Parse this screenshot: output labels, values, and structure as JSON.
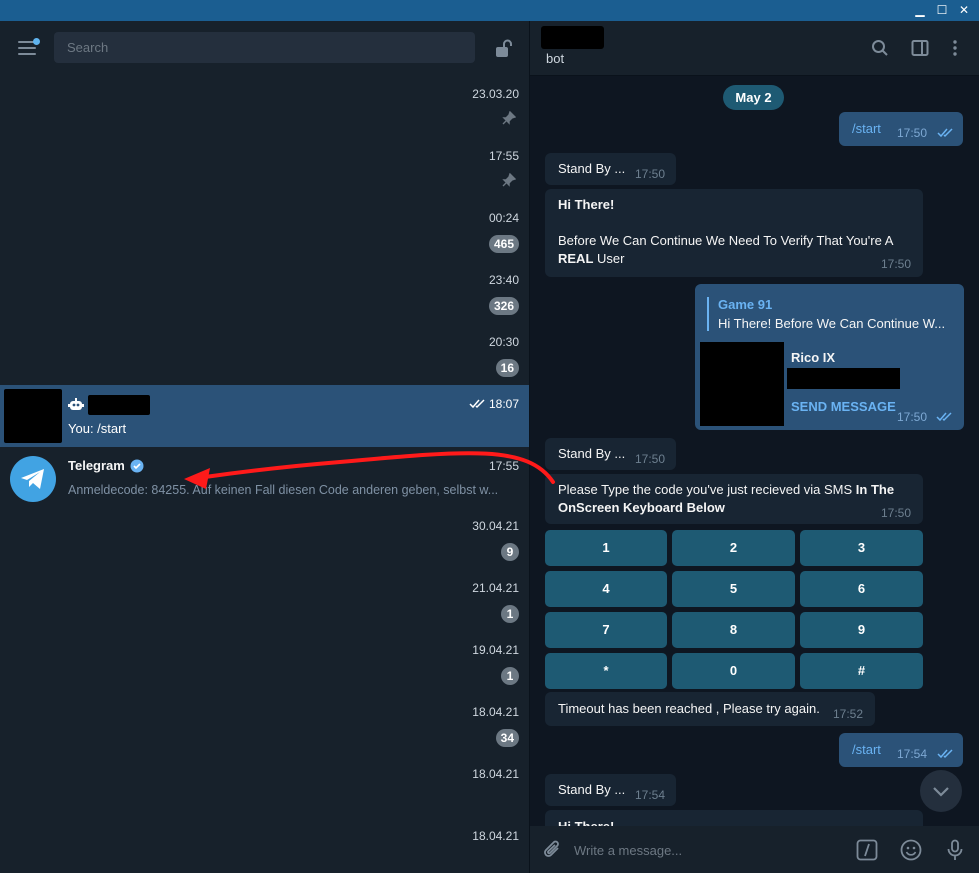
{
  "colors": {
    "titlebar": "#1b5e91",
    "sidebar": "#17212b",
    "chat_bg": "#0e1621",
    "active_row": "#2b5278",
    "keyboard_button": "#1e5a73",
    "annotation_arrow": "#ff1a1a"
  },
  "sidebar": {
    "search_placeholder": "Search",
    "chats": [
      {
        "date": "23.03.20",
        "pinned": true
      },
      {
        "date": "17:55",
        "pinned": true
      },
      {
        "date": "00:24",
        "unread": "465"
      },
      {
        "date": "23:40",
        "unread": "326"
      },
      {
        "date": "20:30",
        "unread": "16"
      },
      {
        "date": "18:07",
        "preview": "You: /start",
        "active": true
      },
      {
        "name": "Telegram",
        "date": "17:55",
        "preview": "Anmeldecode: 84255. Auf keinen Fall diesen Code anderen geben, selbst w..."
      },
      {
        "date": "30.04.21",
        "unread": "9"
      },
      {
        "date": "21.04.21",
        "unread": "1"
      },
      {
        "date": "19.04.21",
        "unread": "1"
      },
      {
        "date": "18.04.21",
        "unread": "34"
      },
      {
        "date": "18.04.21"
      },
      {
        "date": "18.04.21"
      }
    ]
  },
  "chat": {
    "header_subtitle": "bot",
    "date_pill": "May 2",
    "m1": {
      "text": "/start",
      "time": "17:50"
    },
    "m2": {
      "text": "Stand By ...",
      "time": "17:50"
    },
    "m3": {
      "line1": "Hi There!",
      "line2": "Before We Can Continue We Need To Verify That You're A",
      "line3_bold": "REAL",
      "line3_rest": " User",
      "time": "17:50"
    },
    "m4": {
      "quote_title": "Game 91",
      "quote_text": "Hi There!  Before We Can Continue W...",
      "contact_name": "Rico IX",
      "action": "SEND MESSAGE",
      "time": "17:50"
    },
    "m5": {
      "text": "Stand By ...",
      "time": "17:50"
    },
    "m6": {
      "text_a": "Please Type the code you've just recieved via SMS ",
      "text_b": "In The",
      "text_c": "OnScreen Keyboard Below",
      "time": "17:50"
    },
    "keyboard": [
      "1",
      "2",
      "3",
      "4",
      "5",
      "6",
      "7",
      "8",
      "9",
      "*",
      "0",
      "#"
    ],
    "m7": {
      "text": "Timeout has been reached , Please try again.",
      "time": "17:52"
    },
    "m8": {
      "text": "/start",
      "time": "17:54"
    },
    "m9": {
      "text": "Stand By ...",
      "time": "17:54"
    },
    "m10": {
      "text": "Hi There!"
    },
    "composer_placeholder": "Write a message..."
  }
}
